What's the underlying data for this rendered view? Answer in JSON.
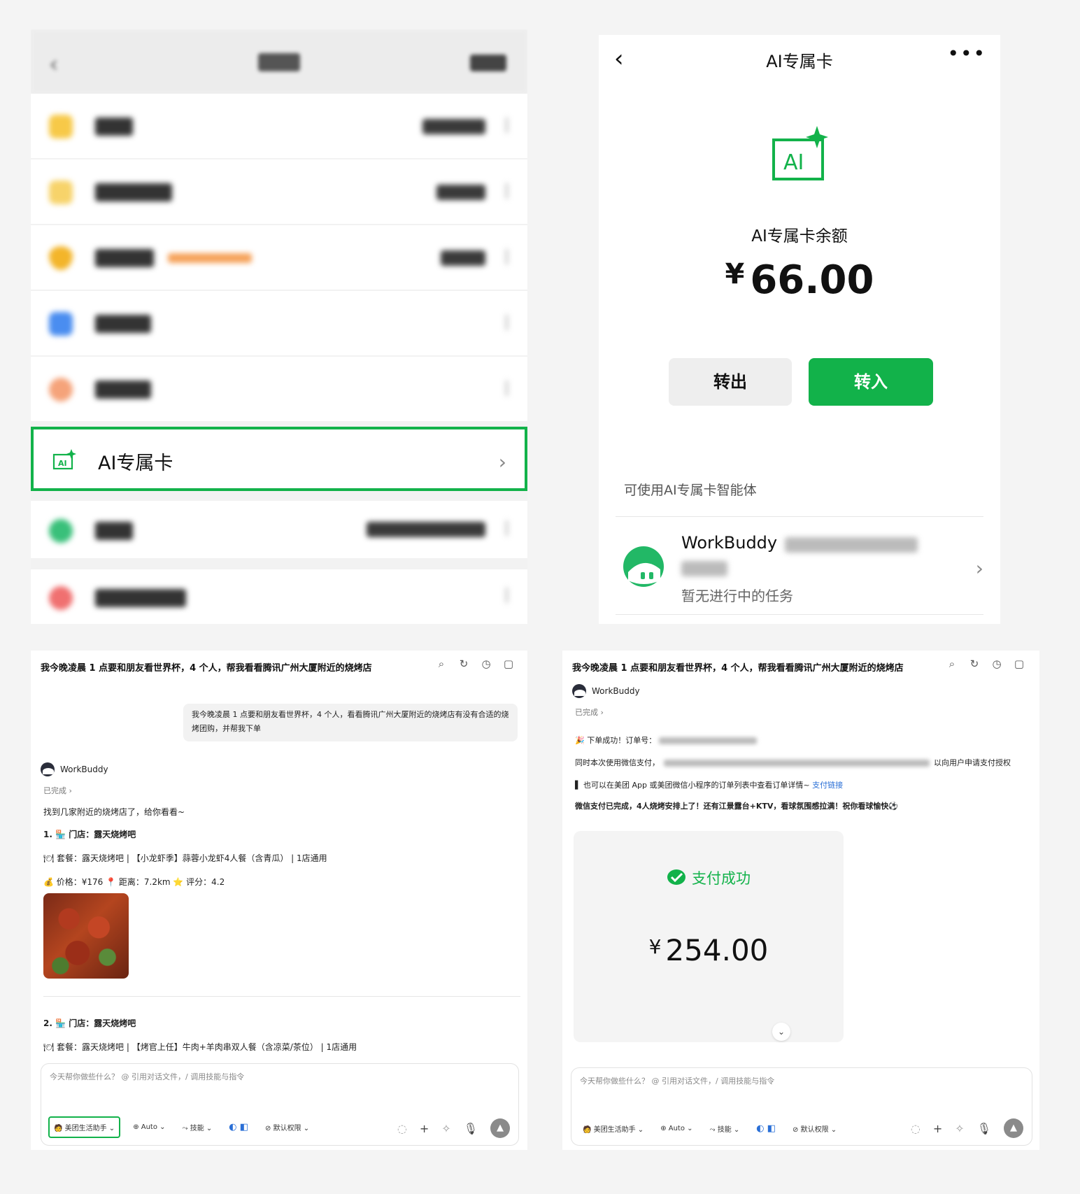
{
  "wallet": {
    "ai_card_label": "AI专属卡",
    "rows": [
      {
        "icon": "coin-icon",
        "color": "#f7c948"
      },
      {
        "icon": "account-icon",
        "color": "#f7c948"
      },
      {
        "icon": "shield-icon",
        "color": "#f3b52a"
      },
      {
        "icon": "bank-card-icon",
        "color": "#4a8df0"
      },
      {
        "icon": "family-card-icon",
        "color": "#f5a37a"
      },
      {
        "icon": "pay-later-icon",
        "color": "#39c07a"
      },
      {
        "icon": "digital-rmb-icon",
        "color": "#f07070"
      }
    ]
  },
  "ai_card": {
    "title": "AI专属卡",
    "more": "•••",
    "balance_label": "AI专属卡余额",
    "currency": "¥",
    "balance": "66.00",
    "transfer_out": "转出",
    "transfer_in": "转入",
    "section_title": "可使用AI专属卡智能体",
    "agent": {
      "name": "WorkBuddy",
      "status": "暂无进行中的任务"
    }
  },
  "chat_left": {
    "title": "我今晚凌晨 1 点要和朋友看世界杯，4 个人，帮我看看腾讯广州大厦附近的烧烤店",
    "user_msg": "我今晚凌晨 1 点要和朋友看世界杯，4 个人，看看腾讯广州大厦附近的烧烤店有没有合适的烧烤团购，并帮我下单",
    "bot_name": "WorkBuddy",
    "done": "已完成 ›",
    "intro": "找到几家附近的烧烤店了，给你看看~",
    "item1_store": "1. 🏪 门店：露天烧烤吧",
    "item1_set": "🍽 套餐：露天烧烤吧 | 【小龙虾季】蒜蓉小龙虾4人餐（含青瓜） | 1店通用",
    "item1_meta": "💰 价格：¥176   📍 距离：7.2km   ⭐ 评分：4.2",
    "item2_store": "2. 🏪 门店：露天烧烤吧",
    "item2_set": "🍽 套餐：露天烧烤吧 | 【烤官上任】牛肉+羊肉串双人餐（含凉菜/茶位） | 1店通用",
    "placeholder": "今天帮你做些什么？ @ 引用对话文件，/ 调用技能与指令",
    "toolbar": {
      "assistant": "🧑 美团生活助手 ⌄",
      "auto": "⊕ Auto ⌄",
      "skills": "⤳ 技能 ⌄",
      "perm": "⊘ 默认权限 ⌄"
    }
  },
  "chat_right": {
    "title": "我今晚凌晨 1 点要和朋友看世界杯，4 个人，帮我看看腾讯广州大厦附近的烧烤店",
    "bot_name": "WorkBuddy",
    "done": "已完成 ›",
    "order_ok": "🎉 下单成功！订单号：",
    "pay_line_a": "同时本次使用微信支付，",
    "pay_line_b": "以向用户申请支付授权",
    "view_line": "▌ 也可以在美团 App 或美团微信小程序的订单列表中查看订单详情~",
    "pay_link": "支付链接",
    "final_line": "微信支付已完成，4人烧烤安排上了！还有江景露台+KTV，看球氛围感拉满！祝你看球愉快⚽",
    "pay_success": "支付成功",
    "currency": "¥",
    "amount": "254.00",
    "placeholder": "今天帮你做些什么？ @ 引用对话文件，/ 调用技能与指令",
    "toolbar": {
      "assistant": "🧑 美团生活助手 ⌄",
      "auto": "⊕ Auto ⌄",
      "skills": "⤳ 技能 ⌄",
      "perm": "⊘ 默认权限 ⌄"
    }
  },
  "colors": {
    "brand_green": "#12b24a"
  }
}
